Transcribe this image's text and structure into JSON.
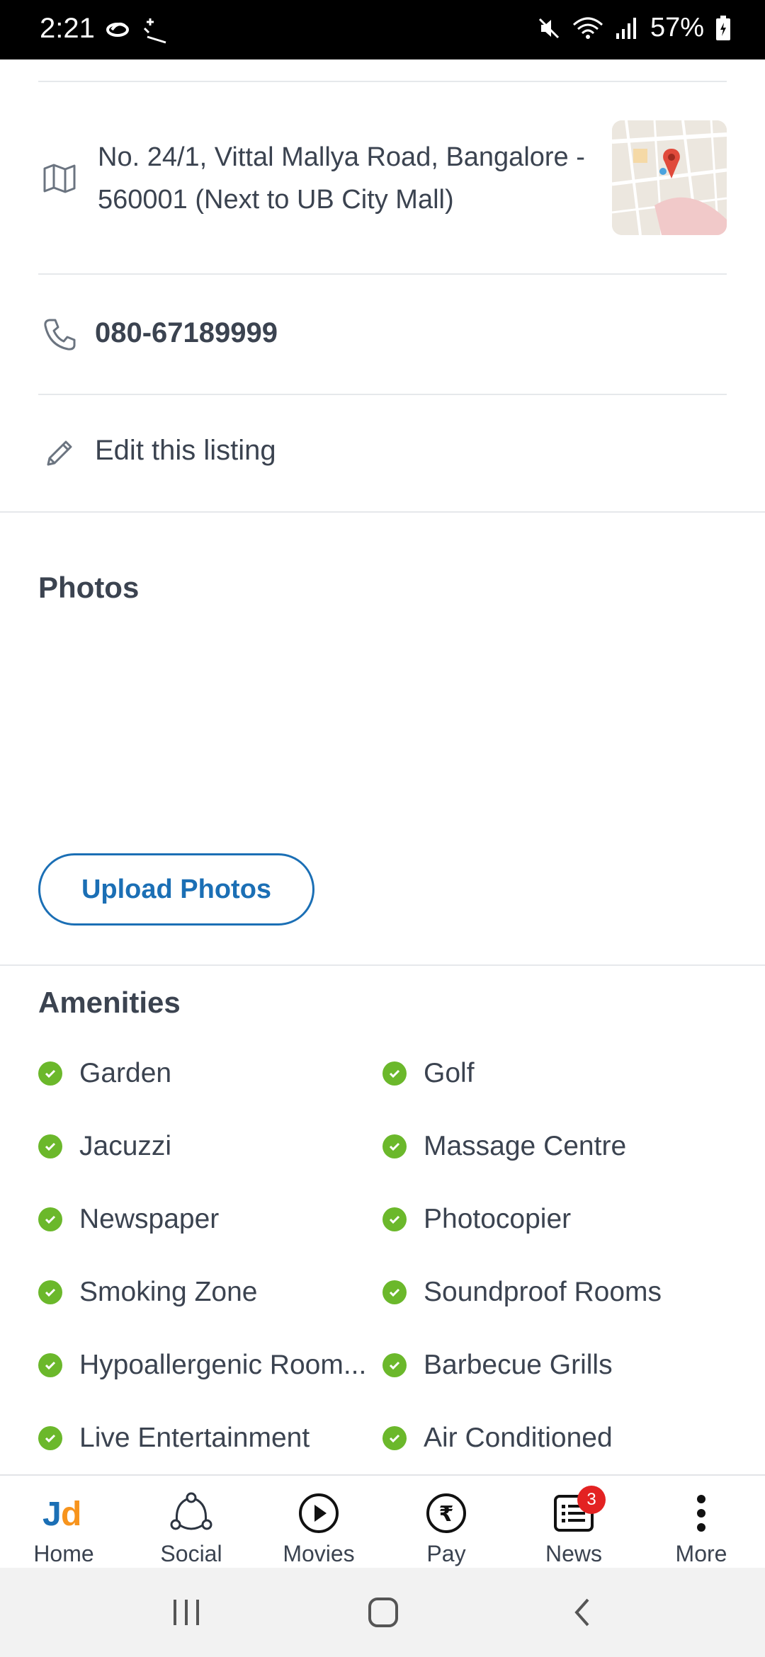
{
  "status_bar": {
    "time": "2:21",
    "battery": "57%",
    "icons": [
      "link-icon",
      "magic-wand-icon",
      "mute-icon",
      "wifi-icon",
      "signal-icon",
      "battery-icon"
    ]
  },
  "listing": {
    "address": "No. 24/1, Vittal Mallya Road, Bangalore - 560001 (Next to UB City Mall)",
    "phone": "080-67189999",
    "edit_label": "Edit this listing"
  },
  "photos": {
    "title": "Photos",
    "upload_label": "Upload Photos"
  },
  "amenities": {
    "title": "Amenities",
    "items": [
      "Garden",
      "Golf",
      "Jacuzzi",
      "Massage Centre",
      "Newspaper",
      "Photocopier",
      "Smoking Zone",
      "Soundproof Rooms",
      "Hypoallergenic Room...",
      "Barbecue Grills",
      "Live Entertainment",
      "Air Conditioned"
    ]
  },
  "bottom_nav": {
    "items": [
      {
        "label": "Home",
        "icon": "jd-logo-icon"
      },
      {
        "label": "Social",
        "icon": "social-icon"
      },
      {
        "label": "Movies",
        "icon": "play-icon"
      },
      {
        "label": "Pay",
        "icon": "rupee-icon"
      },
      {
        "label": "News",
        "icon": "news-icon",
        "badge": "3"
      },
      {
        "label": "More",
        "icon": "more-vertical-icon"
      }
    ]
  },
  "colors": {
    "accent_blue": "#1b6fb5",
    "check_green": "#6bb82b",
    "jd_blue": "#1b6fb5",
    "jd_orange": "#f7941d",
    "badge_red": "#e32222"
  }
}
